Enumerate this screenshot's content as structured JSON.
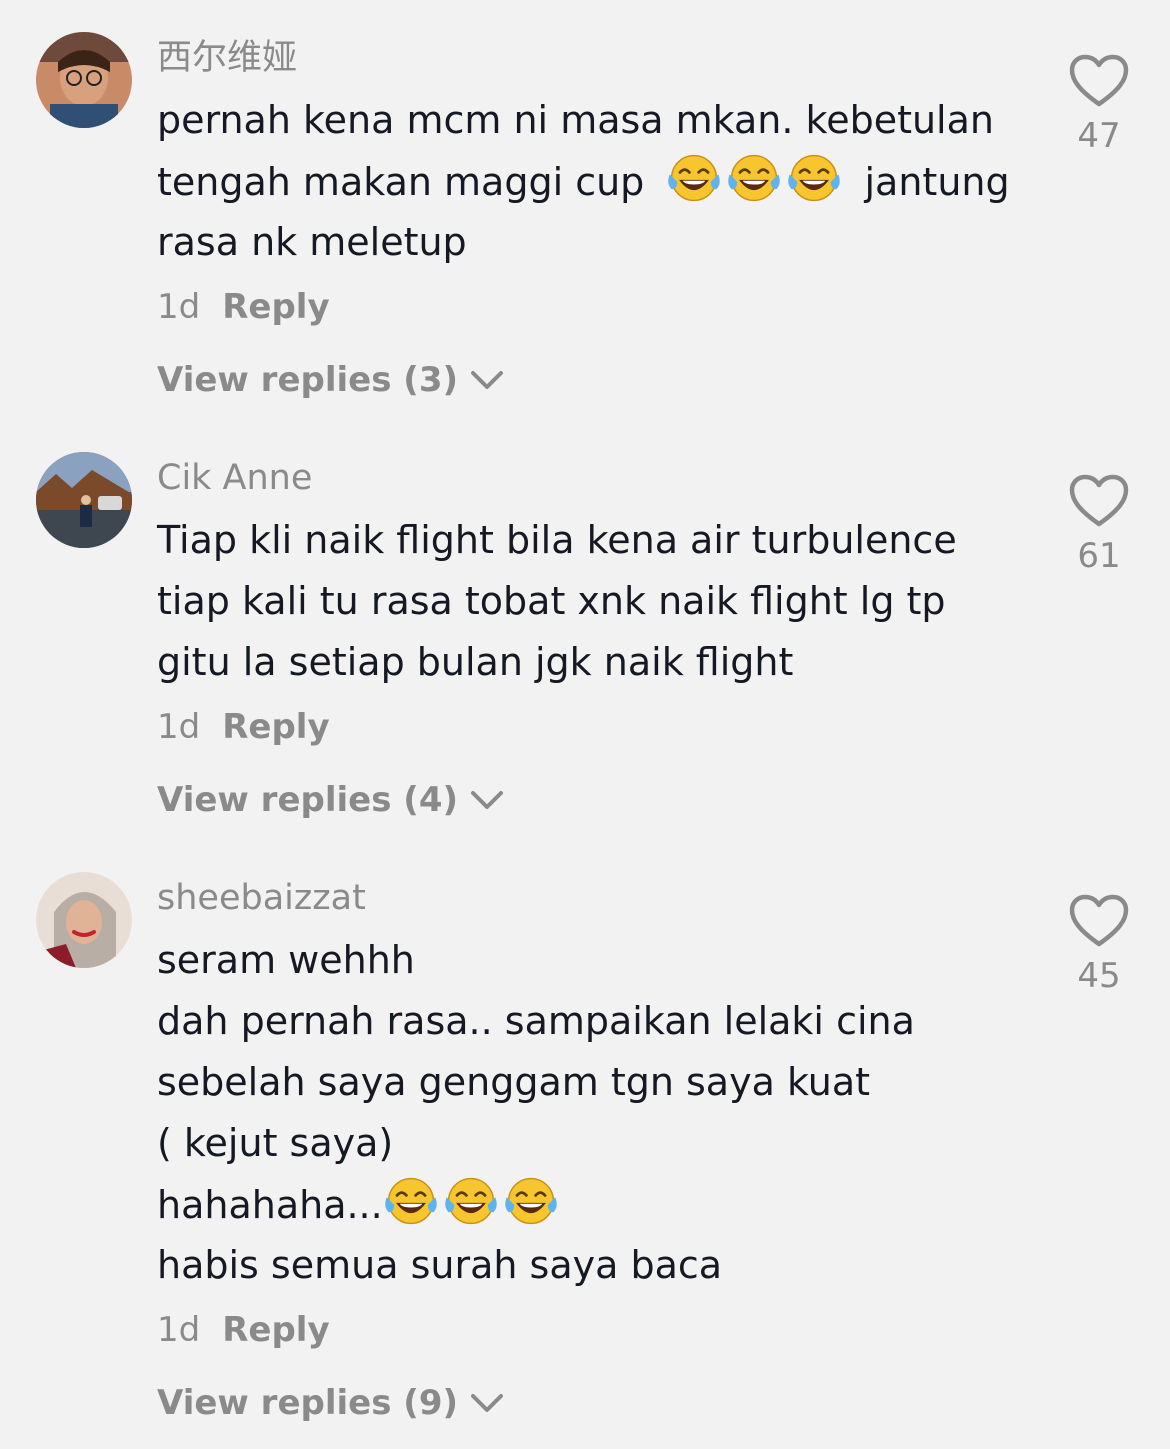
{
  "comments": [
    {
      "username": "西尔维娅",
      "lines": [
        "pernah kena mcm ni masa mkan. kebetulan",
        "tengah makan maggi cup",
        "rasa nk meletup"
      ],
      "line2_suffix": "jantung",
      "age": "1d",
      "reply_label": "Reply",
      "view_replies": "View replies (3)",
      "likes": "47"
    },
    {
      "username": "Cik Anne",
      "lines": [
        "Tiap kli naik flight bila kena air turbulence",
        "tiap kali tu rasa tobat xnk naik flight lg tp",
        "gitu la setiap bulan jgk naik flight"
      ],
      "age": "1d",
      "reply_label": "Reply",
      "view_replies": "View replies (4)",
      "likes": "61"
    },
    {
      "username": "sheebaizzat",
      "lines": [
        "seram wehhh",
        "dah pernah rasa.. sampaikan lelaki cina",
        "sebelah saya genggam tgn saya kuat",
        "( kejut saya)",
        "hahahaha...",
        "habis semua surah saya baca"
      ],
      "age": "1d",
      "reply_label": "Reply",
      "view_replies": "View replies (9)",
      "likes": "45"
    }
  ],
  "icons": {
    "like": "heart-outline-icon",
    "expand": "chevron-down-icon",
    "emoji": "face-with-tears-of-joy-emoji"
  },
  "colors": {
    "background": "#f2f2f2",
    "text": "#161823",
    "secondary": "#8a8a8a"
  }
}
